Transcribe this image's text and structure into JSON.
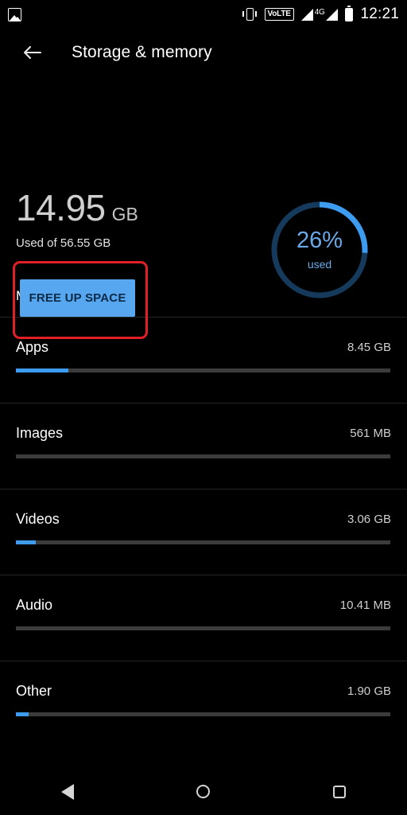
{
  "status_bar": {
    "notification_icon": "photo-icon",
    "vibrate_icon": "vibrate-icon",
    "volte_label": "VoLTE",
    "network_label": "4G",
    "signal_icon": "signal-bars-icon",
    "battery_icon": "battery-icon",
    "time": "12:21"
  },
  "app_bar": {
    "back_icon": "back-arrow-icon",
    "title": "Storage & memory"
  },
  "summary": {
    "used_number": "14.95",
    "used_unit": "GB",
    "used_of": "Used of 56.55 GB",
    "free_up_button": "FREE UP SPACE",
    "annotation_color": "#e02026",
    "accent_color": "#56a6f0"
  },
  "donut": {
    "percent_label": "26%",
    "sub_label": "used",
    "percent_value": 26,
    "arc_color": "#3d9bf0",
    "track_color": "#153a5c",
    "text_color": "#6aa9e8"
  },
  "section": {
    "heading": "Memory"
  },
  "rows": [
    {
      "label": "Apps",
      "value": "8.45 GB",
      "fill_percent": 14.0
    },
    {
      "label": "Images",
      "value": "561 MB",
      "fill_percent": 0.0
    },
    {
      "label": "Videos",
      "value": "3.06 GB",
      "fill_percent": 5.4
    },
    {
      "label": "Audio",
      "value": "10.41 MB",
      "fill_percent": 0.0
    },
    {
      "label": "Other",
      "value": "1.90 GB",
      "fill_percent": 3.4
    }
  ],
  "nav_bar": {
    "back": "back-triangle-icon",
    "home": "home-circle-icon",
    "recents": "recents-square-icon"
  }
}
